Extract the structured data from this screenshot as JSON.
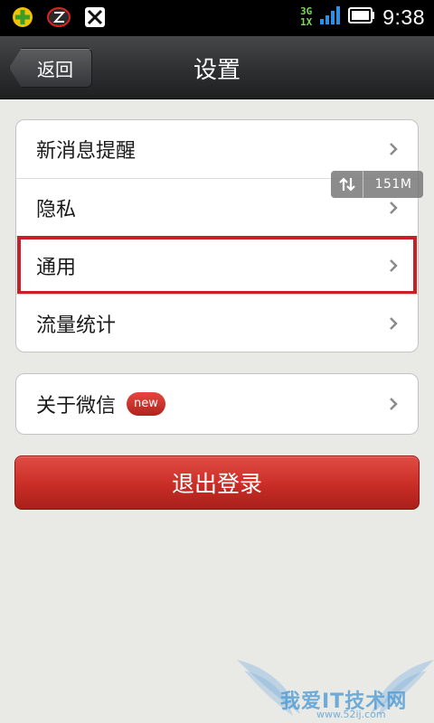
{
  "status_bar": {
    "time": "9:38",
    "network_top": "3G",
    "network_bottom": "1X",
    "icons": [
      "app-add-icon",
      "z-app-icon",
      "x-app-icon",
      "signal-icon",
      "battery-icon"
    ]
  },
  "nav": {
    "back_label": "返回",
    "title": "设置"
  },
  "settings_group": {
    "items": [
      {
        "label": "新消息提醒"
      },
      {
        "label": "隐私"
      },
      {
        "label": "通用"
      },
      {
        "label": "流量统计"
      }
    ]
  },
  "about_group": {
    "label": "关于微信",
    "badge": "new"
  },
  "logout_label": "退出登录",
  "traffic_overlay": {
    "value": "151M"
  },
  "watermark": {
    "text": "我爱IT技术网",
    "url": "www.52ij.com"
  },
  "colors": {
    "accent_red": "#c92d26",
    "highlight_border": "#c8202b",
    "nav_bar": "#2d2f30"
  }
}
